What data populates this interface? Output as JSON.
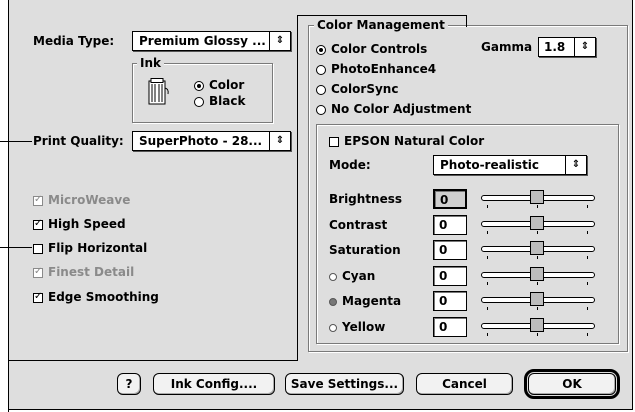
{
  "left": {
    "media_type_label": "Media Type:",
    "media_type_value": "Premium Glossy ...",
    "ink": {
      "title": "Ink",
      "options": [
        {
          "label": "Color",
          "selected": true
        },
        {
          "label": "Black",
          "selected": false
        }
      ]
    },
    "print_quality_label": "Print Quality:",
    "print_quality_value": "SuperPhoto - 28...",
    "checkboxes": [
      {
        "label": "MicroWeave",
        "checked": true,
        "enabled": false
      },
      {
        "label": "High Speed",
        "checked": true,
        "enabled": true
      },
      {
        "label": "Flip Horizontal",
        "checked": false,
        "enabled": true
      },
      {
        "label": "Finest Detail",
        "checked": true,
        "enabled": false
      },
      {
        "label": "Edge Smoothing",
        "checked": true,
        "enabled": true
      }
    ]
  },
  "color_management": {
    "title": "Color Management",
    "options": [
      {
        "label": "Color Controls",
        "selected": true
      },
      {
        "label": "PhotoEnhance4",
        "selected": false
      },
      {
        "label": "ColorSync",
        "selected": false
      },
      {
        "label": "No Color Adjustment",
        "selected": false
      }
    ],
    "gamma_label": "Gamma",
    "gamma_value": "1.8",
    "epson_natural_color_label": "EPSON Natural Color",
    "mode_label": "Mode:",
    "mode_value": "Photo-realistic",
    "adjustments": [
      {
        "label": "Brightness",
        "value": "0",
        "dot": "none",
        "position": 0.5
      },
      {
        "label": "Contrast",
        "value": "0",
        "dot": "none",
        "position": 0.5
      },
      {
        "label": "Saturation",
        "value": "0",
        "dot": "none",
        "position": 0.5
      },
      {
        "label": "Cyan",
        "value": "0",
        "dot": "hollow",
        "position": 0.5
      },
      {
        "label": "Magenta",
        "value": "0",
        "dot": "filled",
        "position": 0.5
      },
      {
        "label": "Yellow",
        "value": "0",
        "dot": "hollow",
        "position": 0.5
      }
    ]
  },
  "buttons": {
    "help": "?",
    "ink_config": "Ink Config....",
    "save_settings": "Save Settings...",
    "cancel": "Cancel",
    "ok": "OK"
  },
  "colors": {
    "dialog_bg": "#dedede",
    "disabled_text": "#8a8a8a"
  }
}
